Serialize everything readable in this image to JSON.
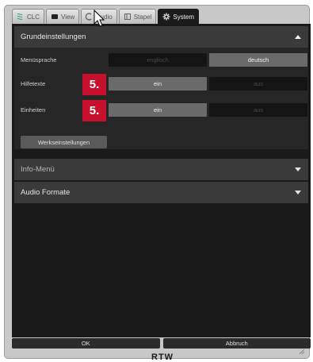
{
  "tabs": [
    {
      "label": "CLC",
      "icon": "clc-icon"
    },
    {
      "label": "View",
      "icon": "monitor-icon"
    },
    {
      "label": "Audio",
      "icon": "audio-icon"
    },
    {
      "label": "Stapel",
      "icon": "stack-icon"
    },
    {
      "label": "System",
      "icon": "gear-icon",
      "active": true
    }
  ],
  "sections": {
    "basic": {
      "title": "Grundeinstellungen",
      "expanded": true,
      "rows": [
        {
          "label": "Menüsprache",
          "options": [
            "englisch",
            "deutsch"
          ],
          "selected": "deutsch"
        },
        {
          "label": "Hilfetexte",
          "options": [
            "ein",
            "aus"
          ],
          "selected": "ein",
          "badge": "5."
        },
        {
          "label": "Einheiten",
          "options": [
            "ein",
            "aus"
          ],
          "selected": "ein",
          "badge": "5."
        }
      ],
      "factory_button": "Werkseinstellungen"
    },
    "info": {
      "title": "Info-Menü",
      "expanded": false
    },
    "audio": {
      "title": "Audio Formate",
      "expanded": false
    }
  },
  "footer": {
    "ok": "OK",
    "cancel": "Abbruch"
  },
  "brand": "RTW",
  "colors": {
    "accent_badge": "#c7102e",
    "panel_bg": "#1a1a1a",
    "selected_option": "#6a6a6a"
  }
}
